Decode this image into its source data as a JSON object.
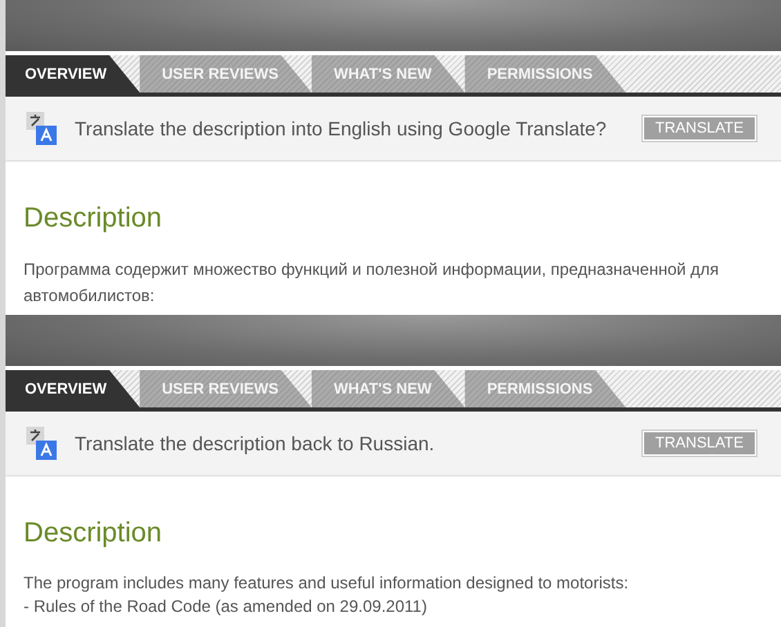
{
  "panels": [
    {
      "tabs": [
        {
          "label": "OVERVIEW",
          "selected": true
        },
        {
          "label": "USER REVIEWS",
          "selected": false
        },
        {
          "label": "WHAT'S NEW",
          "selected": false
        },
        {
          "label": "PERMISSIONS",
          "selected": false
        }
      ],
      "translate": {
        "message": "Translate the description into English using Google Translate?",
        "button": "TRANSLATE"
      },
      "description": {
        "heading": "Description",
        "lines": [
          "Программа содержит множество функций и полезной информации, предназначенной для автомобилистов:"
        ]
      }
    },
    {
      "tabs": [
        {
          "label": "OVERVIEW",
          "selected": true
        },
        {
          "label": "USER REVIEWS",
          "selected": false
        },
        {
          "label": "WHAT'S NEW",
          "selected": false
        },
        {
          "label": "PERMISSIONS",
          "selected": false
        }
      ],
      "translate": {
        "message": "Translate the description back to Russian.",
        "button": "TRANSLATE"
      },
      "description": {
        "heading": "Description",
        "lines": [
          "The program includes many features and useful information designed to motorists:",
          "- Rules of the Road Code (as amended on 29.09.2011)"
        ]
      }
    }
  ]
}
